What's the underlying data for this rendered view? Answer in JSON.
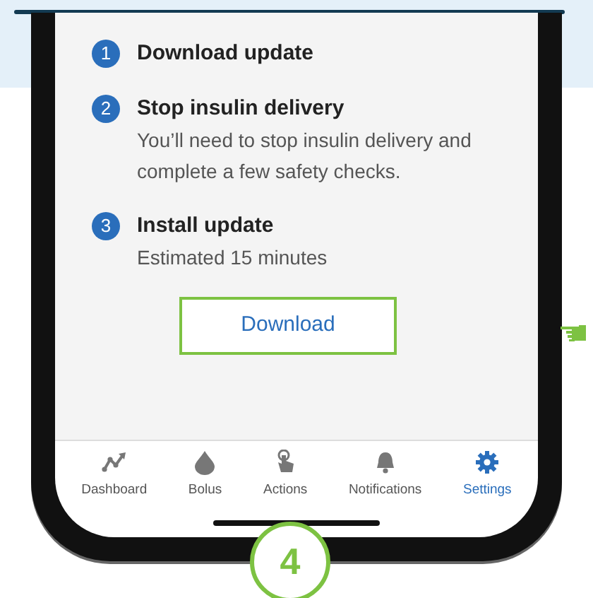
{
  "steps": [
    {
      "number": "1",
      "title": "Download update"
    },
    {
      "number": "2",
      "title": "Stop insulin delivery",
      "description": "You’ll need to stop insulin delivery and complete a few safety checks."
    },
    {
      "number": "3",
      "title": "Install update",
      "description": "Estimated 15 minutes"
    }
  ],
  "button": "Download",
  "tabs": [
    {
      "kind": "chart",
      "label": "Dashboard",
      "selected": false
    },
    {
      "kind": "drop",
      "label": "Bolus",
      "selected": false
    },
    {
      "kind": "hand",
      "label": "Actions",
      "selected": false
    },
    {
      "kind": "bell",
      "label": "Notifications",
      "selected": false
    },
    {
      "kind": "gear",
      "label": "Settings",
      "selected": true
    }
  ],
  "step_badge": "4"
}
